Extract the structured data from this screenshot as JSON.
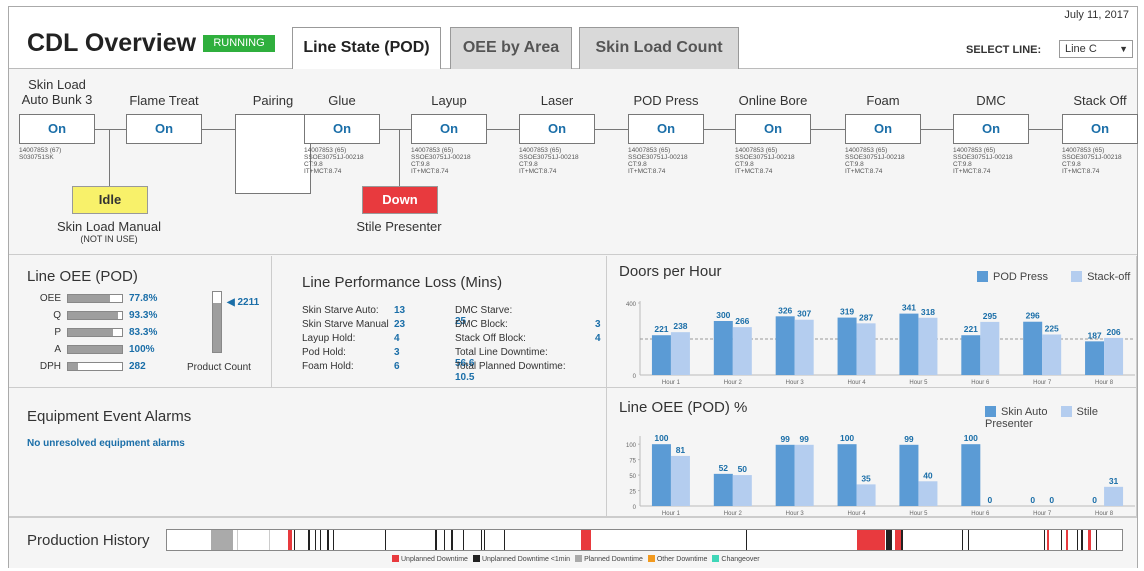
{
  "header": {
    "title": "CDL Overview",
    "status_badge": "RUNNING",
    "tabs": [
      {
        "label": "Line State (POD)",
        "active": true
      },
      {
        "label": "OEE by Area",
        "active": false
      },
      {
        "label": "Skin Load Count",
        "active": false
      }
    ],
    "date": "July 11, 2017",
    "select_line_label": "SELECT LINE:",
    "select_line_value": "Line C"
  },
  "line_state": {
    "stations": [
      {
        "name": "Skin Load\nAuto Bunk 3",
        "status": "On",
        "meta": "14007853 (67)\nS030751SK"
      },
      {
        "name": "Flame Treat",
        "status": "On",
        "meta": ""
      },
      {
        "name": "Pairing",
        "status": "",
        "meta": ""
      },
      {
        "name": "Glue",
        "status": "On",
        "meta": "14007853 (65)\nSSOE30751J-00218\nCT:9.8\nIT+MCT:8.74"
      },
      {
        "name": "Layup",
        "status": "On",
        "meta": "14007853 (65)\nSSOE30751J-00218\nCT:9.8\nIT+MCT:8.74"
      },
      {
        "name": "Laser",
        "status": "On",
        "meta": "14007853 (65)\nSSOE30751J-00218\nCT:9.8\nIT+MCT:8.74"
      },
      {
        "name": "POD Press",
        "status": "On",
        "meta": "14007853 (65)\nSSOE30751J-00218\nCT:9.8\nIT+MCT:8.74"
      },
      {
        "name": "Online Bore",
        "status": "On",
        "meta": "14007853 (65)\nSSOE30751J-00218\nCT:9.8\nIT+MCT:8.74"
      },
      {
        "name": "Foam",
        "status": "On",
        "meta": "14007853 (65)\nSSOE30751J-00218\nCT:9.8\nIT+MCT:8.74"
      },
      {
        "name": "DMC",
        "status": "On",
        "meta": "14007853 (65)\nSSOE30751J-00218\nCT:9.8\nIT+MCT:8.74"
      },
      {
        "name": "Stack Off",
        "status": "On",
        "meta": "14007853 (65)\nSSOE30751J-00218\nCT:9.8\nIT+MCT:8.74"
      }
    ],
    "sub_stations": [
      {
        "status": "Idle",
        "name": "Skin Load Manual",
        "note": "(NOT IN USE)",
        "color": "#f8f16a"
      },
      {
        "status": "Down",
        "name": "Stile Presenter",
        "note": "",
        "color": "#e83a3e"
      }
    ]
  },
  "line_oee": {
    "title": "Line OEE (POD)",
    "rows": [
      {
        "label": "OEE",
        "value": "77.8%",
        "fraction": 0.778
      },
      {
        "label": "Q",
        "value": "93.3%",
        "fraction": 0.933
      },
      {
        "label": "P",
        "value": "83.3%",
        "fraction": 0.833
      },
      {
        "label": "A",
        "value": "100%",
        "fraction": 1.0
      },
      {
        "label": "DPH",
        "value": "282",
        "fraction": 0.18
      }
    ],
    "product_count": "2211",
    "product_count_fraction": 0.82,
    "product_count_label": "Product Count"
  },
  "performance_loss": {
    "title": "Line Performance Loss (Mins)",
    "left": [
      {
        "label": "Skin Starve Auto:",
        "value": "13"
      },
      {
        "label": "Skin Starve Manual",
        "value": "23"
      },
      {
        "label": "Layup Hold:",
        "value": "4"
      },
      {
        "label": "Pod Hold:",
        "value": "3"
      },
      {
        "label": "Foam Hold:",
        "value": "6"
      }
    ],
    "right": [
      {
        "label": "DMC Starve:",
        "value": "25"
      },
      {
        "label": "DMC Block:",
        "value": "3"
      },
      {
        "label": "Stack Off Block:",
        "value": "4"
      },
      {
        "label": "Total Line Downtime:",
        "value": "56.6"
      },
      {
        "label": "Total Planned Downtime:",
        "value": "10.5"
      }
    ]
  },
  "alarms": {
    "title": "Equipment Event Alarms",
    "message": "No unresolved equipment alarms"
  },
  "production_history": {
    "title": "Production History",
    "legend": [
      {
        "label": "Unplanned Downtime",
        "color": "#e83a3e"
      },
      {
        "label": "Unplanned Downtime <1min",
        "color": "#222222"
      },
      {
        "label": "Planned Downtime",
        "color": "#aaaaaa"
      },
      {
        "label": "Other Downtime",
        "color": "#f29a1f"
      },
      {
        "label": "Changeover",
        "color": "#3fd6b8"
      }
    ]
  },
  "chart_data": [
    {
      "type": "bar",
      "title": "Doors per Hour",
      "categories": [
        "Hour 1",
        "Hour 2",
        "Hour 3",
        "Hour 4",
        "Hour 5",
        "Hour 6",
        "Hour 7",
        "Hour 8"
      ],
      "series": [
        {
          "name": "POD Press",
          "values": [
            221,
            300,
            326,
            319,
            341,
            221,
            296,
            187
          ],
          "color": "#5b9bd5"
        },
        {
          "name": "Stack-off",
          "values": [
            238,
            266,
            307,
            287,
            318,
            295,
            225,
            206
          ],
          "color": "#b4cdef"
        }
      ],
      "yticks": [
        0,
        400
      ],
      "ylim": [
        0,
        400
      ],
      "reference_line": 200,
      "legend_position": "top-right"
    },
    {
      "type": "bar",
      "title": "Line OEE (POD) %",
      "categories": [
        "Hour 1",
        "Hour 2",
        "Hour 3",
        "Hour 4",
        "Hour 5",
        "Hour 6",
        "Hour 7",
        "Hour 8"
      ],
      "series": [
        {
          "name": "Skin Auto",
          "values": [
            100,
            52,
            99,
            100,
            99,
            100,
            0,
            0
          ],
          "color": "#5b9bd5"
        },
        {
          "name": "Stile Presenter",
          "values": [
            81,
            50,
            99,
            35,
            40,
            0,
            0,
            31
          ],
          "color": "#b4cdef"
        }
      ],
      "yticks": [
        0,
        25,
        50,
        75,
        100
      ],
      "ylim": [
        0,
        110
      ],
      "legend_position": "top-right"
    }
  ]
}
